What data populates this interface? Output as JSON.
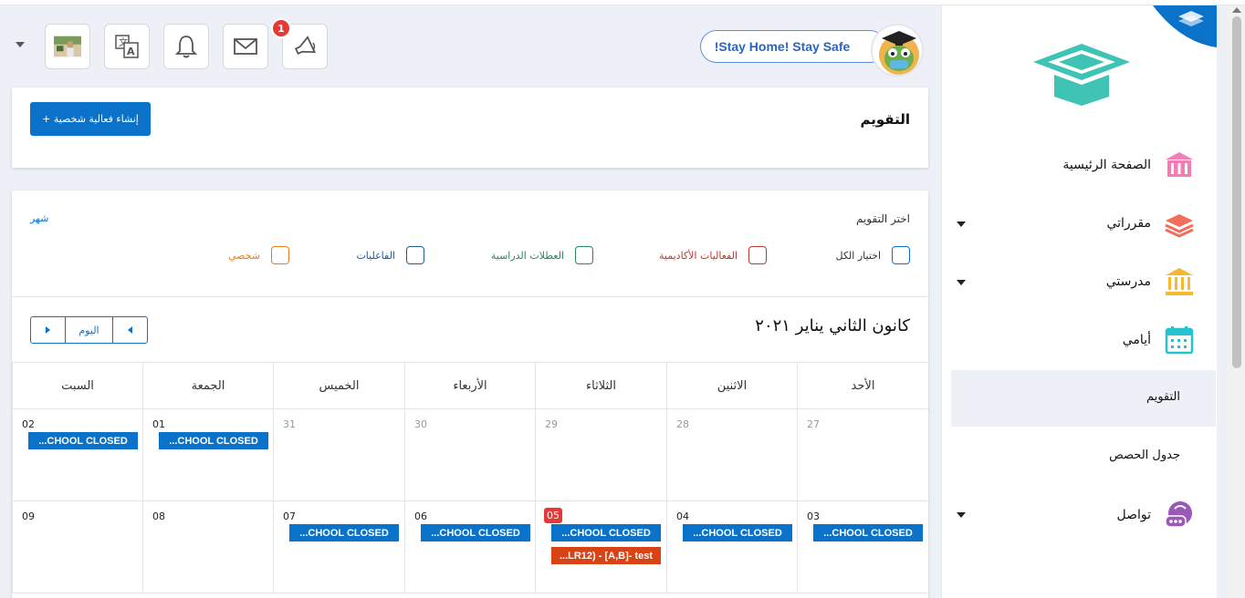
{
  "header": {
    "notification_count": "1",
    "stay_home_text": "!Stay Home! Stay Safe"
  },
  "page": {
    "title": "التقويم",
    "create_button": "+ إنشاء فعالية شخصية"
  },
  "calendar": {
    "filter_label": "اختر التقويم",
    "view_month": "شهر",
    "filters": [
      {
        "label": "اختيار الكل",
        "color": "#0a73c9"
      },
      {
        "label": "الفعاليات الأكاديمية",
        "color": "#c0392b"
      },
      {
        "label": "العطلات الدراسية",
        "color": "#27885a"
      },
      {
        "label": "الفاعليات",
        "color": "#1c5e9c"
      },
      {
        "label": "شخصي",
        "color": "#e67e22"
      }
    ],
    "month_title": "كانون الثاني يناير ٢٠٢١",
    "today_label": "اليوم",
    "weekdays": [
      "الأحد",
      "الاثنين",
      "الثلاثاء",
      "الأربعاء",
      "الخميس",
      "الجمعة",
      "السبت"
    ],
    "week1": [
      "27",
      "28",
      "29",
      "30",
      "31",
      "01",
      "02"
    ],
    "week2": [
      "03",
      "04",
      "05",
      "06",
      "07",
      "08",
      "09"
    ],
    "event_closed": "...CHOOL CLOSED",
    "event_test": "...LR12) - [A,B]- test",
    "closed_color": "#0a73c9",
    "test_color": "#d84315"
  },
  "sidebar": {
    "items": [
      {
        "label": "الصفحة الرئيسية",
        "icon": "school-building-icon"
      },
      {
        "label": "مقرراتي",
        "icon": "books-stack-icon"
      },
      {
        "label": "مدرستي",
        "icon": "institution-icon"
      },
      {
        "label": "أيامي",
        "icon": "calendar-icon"
      },
      {
        "label": "تواصل",
        "icon": "chat-bubble-icon"
      }
    ],
    "sub_items": [
      "التقويم",
      "جدول الحصص"
    ]
  }
}
